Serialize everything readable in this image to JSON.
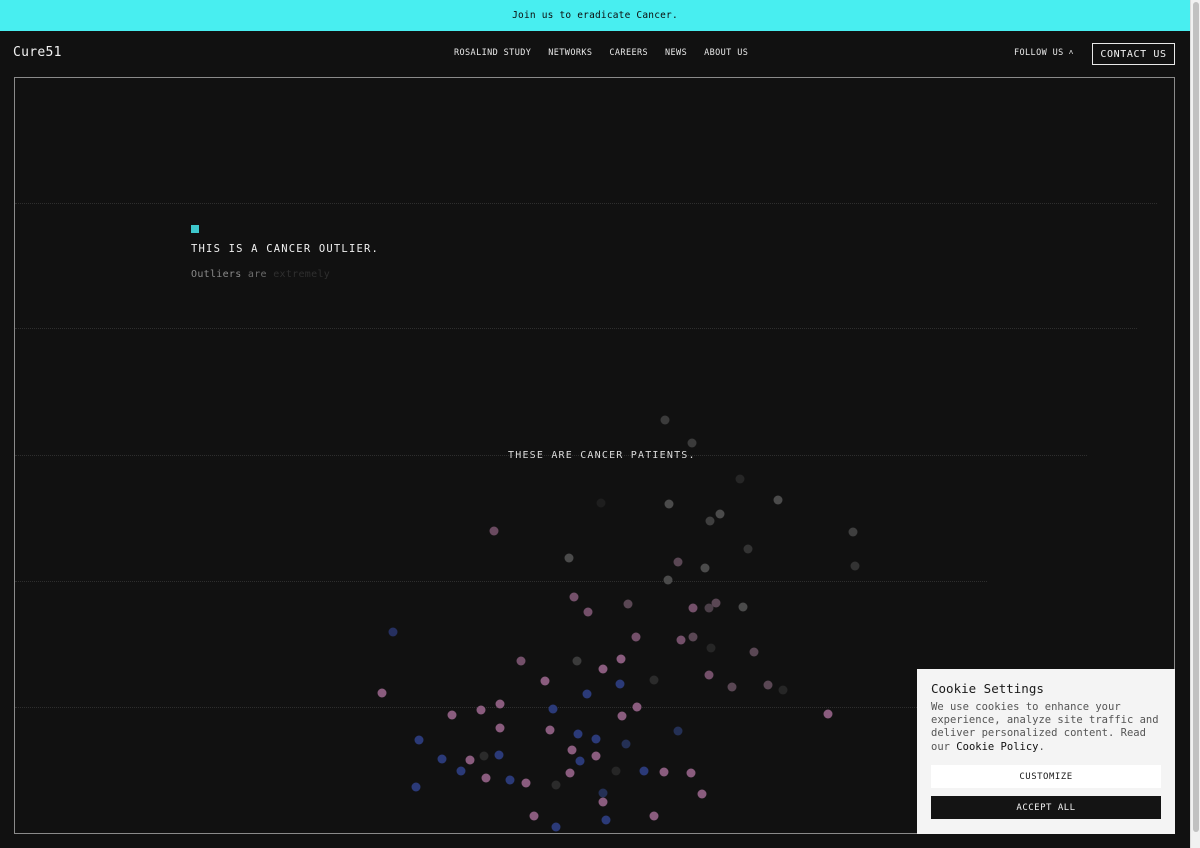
{
  "banner": {
    "text": "Join us to eradicate Cancer."
  },
  "header": {
    "logo": "Cure51",
    "nav": [
      "ROSALIND STUDY",
      "NETWORKS",
      "CAREERS",
      "NEWS",
      "ABOUT US"
    ],
    "follow_label": "FOLLOW US",
    "contact_label": "CONTACT US"
  },
  "hero": {
    "outlier_title": "THIS IS A CANCER OUTLIER.",
    "outlier_words": [
      "Outliers",
      "are",
      "extremely"
    ],
    "patients_label": "THESE ARE CANCER PATIENTS."
  },
  "cookie": {
    "title": "Cookie Settings",
    "body": "We use cookies to enhance your experience, analyze site traffic and deliver personalized content. Read our",
    "policy_link": "Cookie Policy",
    "body_end": ".",
    "customize_label": "CUSTOMIZE",
    "accept_label": "ACCEPT ALL"
  },
  "colors": {
    "accent": "#48eef0",
    "dot_pink": "#8a5c7e",
    "dot_blue": "#2b3a78",
    "dot_gray": "#3b3b3b"
  },
  "icons": {
    "follow_chevron": "chevron-up-icon"
  }
}
